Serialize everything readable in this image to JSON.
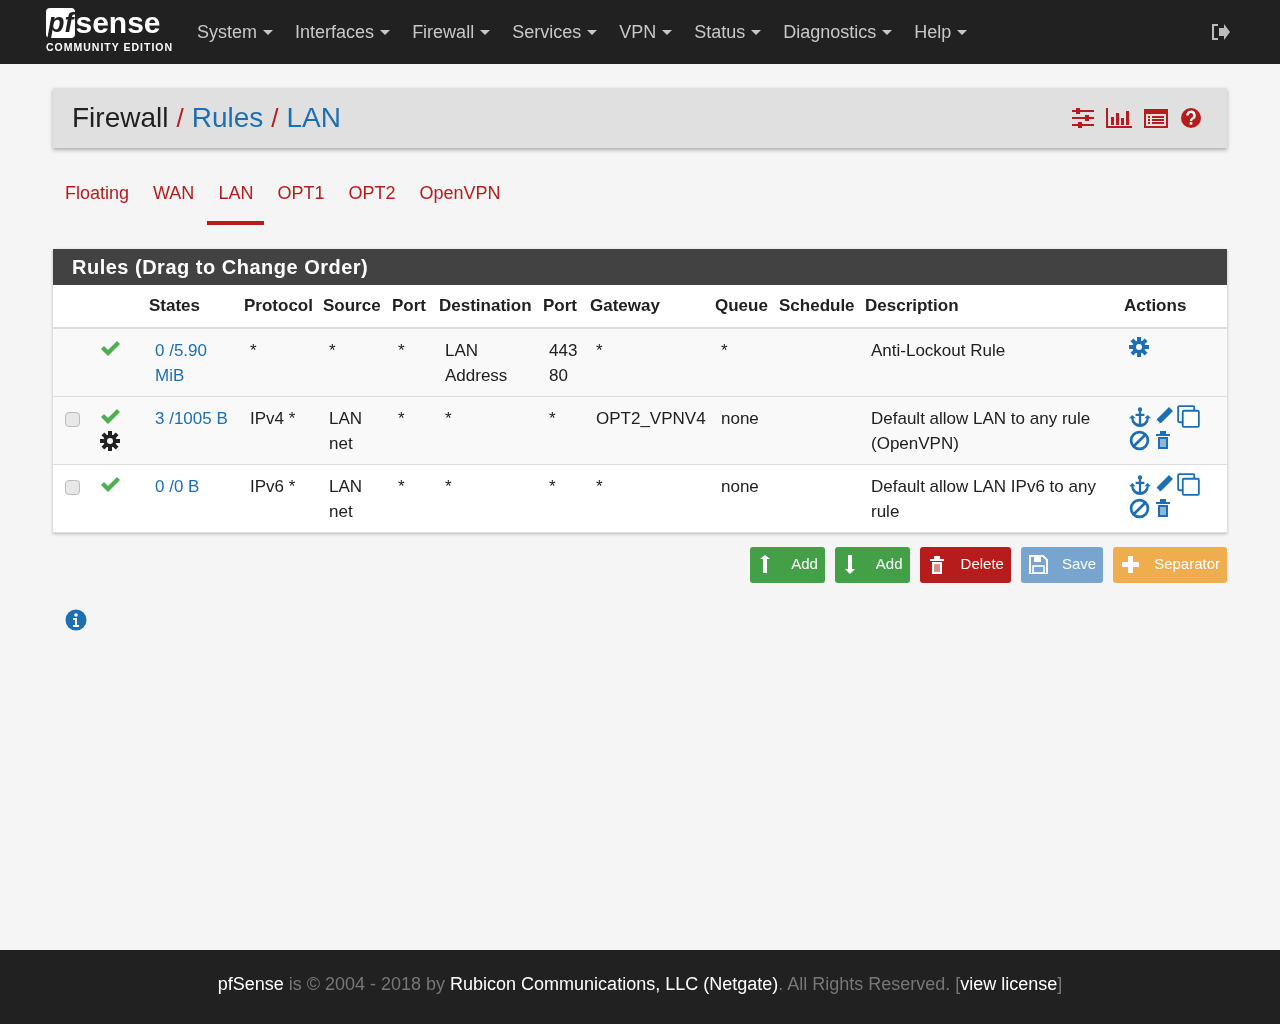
{
  "navbar": {
    "logo": {
      "prefix": "pf",
      "name": "sense",
      "edition": "COMMUNITY EDITION"
    },
    "menus": [
      "System",
      "Interfaces",
      "Firewall",
      "Services",
      "VPN",
      "Status",
      "Diagnostics",
      "Help"
    ]
  },
  "breadcrumb": [
    {
      "text": "Firewall",
      "kind": "title"
    },
    {
      "text": "/",
      "kind": "separator"
    },
    {
      "text": "Rules",
      "kind": "link"
    },
    {
      "text": "/",
      "kind": "separator"
    },
    {
      "text": "LAN",
      "kind": "link"
    }
  ],
  "tabs": [
    {
      "label": "Floating",
      "selected": false
    },
    {
      "label": "WAN",
      "selected": false
    },
    {
      "label": "LAN",
      "selected": true
    },
    {
      "label": "OPT1",
      "selected": false
    },
    {
      "label": "OPT2",
      "selected": false
    },
    {
      "label": "OpenVPN",
      "selected": false
    }
  ],
  "panel": {
    "title": "Rules (Drag to Change Order)",
    "columns": [
      "States",
      "Protocol",
      "Source",
      "Port",
      "Destination",
      "Port",
      "Gateway",
      "Queue",
      "Schedule",
      "Description",
      "Actions"
    ],
    "rows": [
      {
        "kind": "anti-lockout",
        "enabled": true,
        "advanced": false,
        "states": "0 /5.90 MiB",
        "protocol": "*",
        "source": "*",
        "source_port": "*",
        "destination": "LAN Address",
        "destination_port": "443 80",
        "gateway": "*",
        "queue": "*",
        "description": "Anti-Lockout Rule"
      },
      {
        "kind": "rule",
        "checked": false,
        "enabled": true,
        "advanced": true,
        "states": "3 /1005 B",
        "protocol": "IPv4 *",
        "source": "LAN net",
        "source_port": "*",
        "destination": "*",
        "destination_port": "*",
        "gateway": "OPT2_VPNV4",
        "queue": "none",
        "description": "Default allow LAN to any rule (OpenVPN)"
      },
      {
        "kind": "rule",
        "checked": false,
        "enabled": true,
        "advanced": false,
        "states": "0 /0 B",
        "protocol": "IPv6 *",
        "source": "LAN net",
        "source_port": "*",
        "destination": "*",
        "destination_port": "*",
        "gateway": "*",
        "queue": "none",
        "description": "Default allow LAN IPv6 to any rule"
      }
    ]
  },
  "buttons": [
    {
      "kind": "add-top",
      "label": "Add"
    },
    {
      "kind": "add-bottom",
      "label": "Add"
    },
    {
      "kind": "delete",
      "label": "Delete"
    },
    {
      "kind": "save",
      "label": "Save"
    },
    {
      "kind": "separator",
      "label": "Separator"
    }
  ],
  "footer": [
    {
      "text": "pfSense",
      "kind": "strong"
    },
    {
      "text": " is © 2004 - 2018 by ",
      "kind": "muted"
    },
    {
      "text": "Rubicon Communications, LLC (Netgate)",
      "kind": "strong"
    },
    {
      "text": ". All Rights Reserved. [",
      "kind": "muted"
    },
    {
      "text": "view license",
      "kind": "link"
    },
    {
      "text": "]",
      "kind": "muted"
    }
  ]
}
